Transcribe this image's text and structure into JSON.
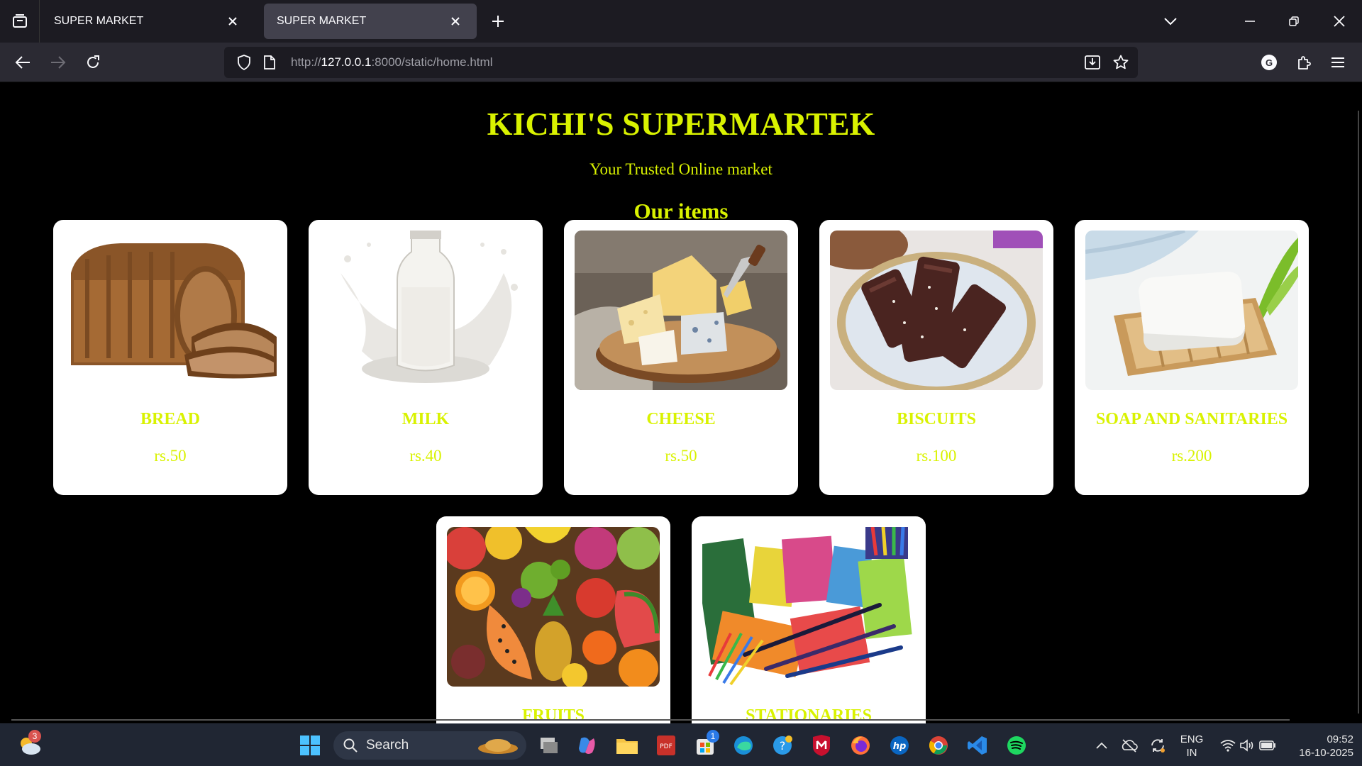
{
  "browser": {
    "tabs": [
      {
        "title": "SUPER MARKET",
        "active": false
      },
      {
        "title": "SUPER MARKET",
        "active": true
      }
    ],
    "url_prefix": "http://",
    "url_host": "127.0.0.1",
    "url_rest": ":8000/static/home.html",
    "profile_initial": "G"
  },
  "page": {
    "title": "KICHI'S SUPERMARTEK",
    "subtitle": "Your Trusted Online market",
    "section_title": "Our items",
    "items": [
      {
        "name": "BREAD",
        "price": "rs.50",
        "image": "bread"
      },
      {
        "name": "MILK",
        "price": "rs.40",
        "image": "milk"
      },
      {
        "name": "CHEESE",
        "price": "rs.50",
        "image": "cheese"
      },
      {
        "name": "BISCUITS",
        "price": "rs.100",
        "image": "biscuits"
      },
      {
        "name": "SOAP AND SANITARIES",
        "price": "rs.200",
        "image": "soap"
      },
      {
        "name": "FRUITS",
        "price": "",
        "image": "fruits"
      },
      {
        "name": "STATIONARIES",
        "price": "",
        "image": "stationery"
      }
    ],
    "accent_color": "#d9f200"
  },
  "taskbar": {
    "search_label": "Search",
    "weather_badge": "3",
    "store_badge": "1",
    "language": "ENG",
    "region": "IN",
    "time": "09:52",
    "date": "16-10-2025"
  }
}
